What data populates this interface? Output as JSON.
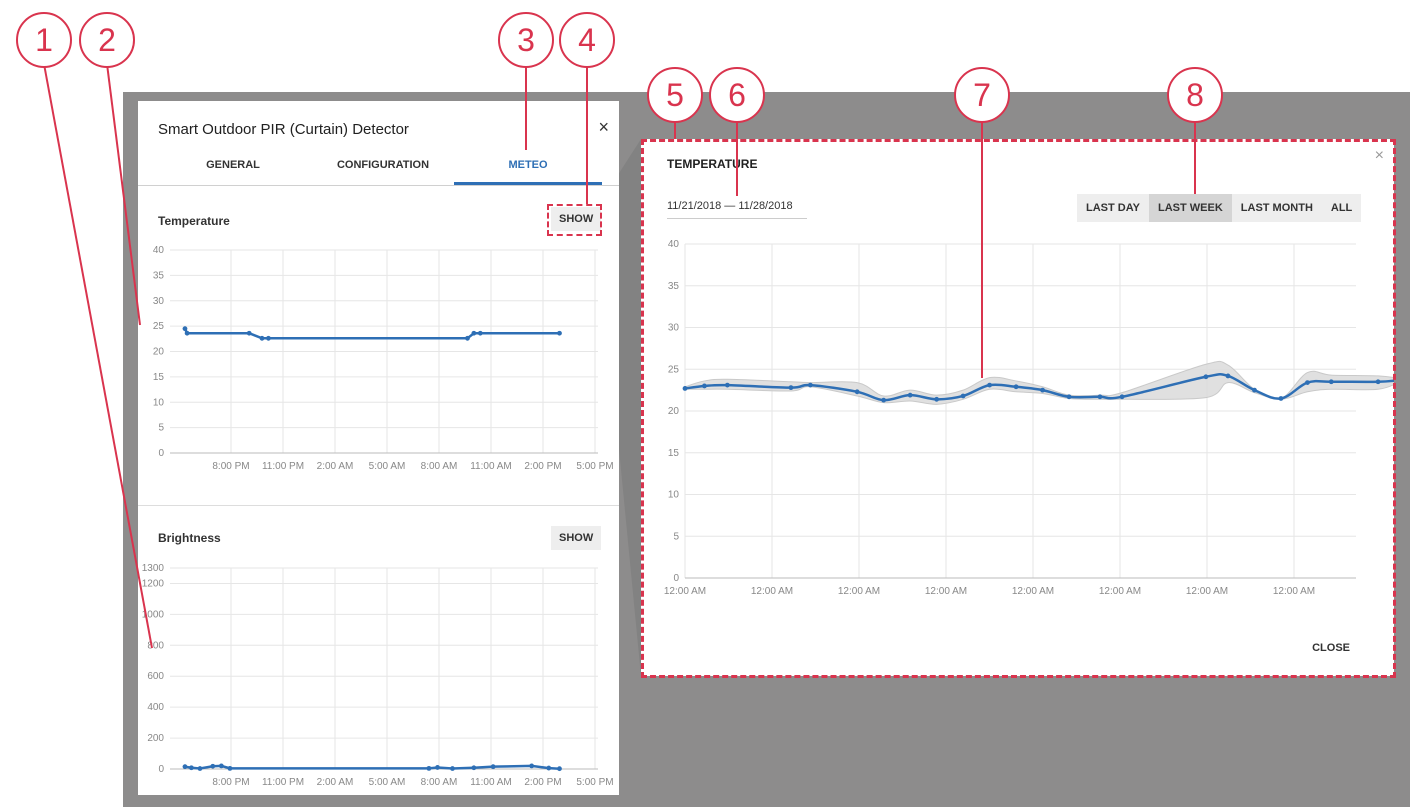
{
  "dialog": {
    "title": "Smart Outdoor PIR (Curtain) Detector",
    "close_symbol": "×",
    "tabs": [
      {
        "label": "GENERAL",
        "active": false
      },
      {
        "label": "CONFIGURATION",
        "active": false
      },
      {
        "label": "METEO",
        "active": true
      }
    ],
    "sections": {
      "temperature": {
        "title": "Temperature",
        "show_label": "SHOW"
      },
      "brightness": {
        "title": "Brightness",
        "show_label": "SHOW"
      }
    }
  },
  "expanded_panel": {
    "title": "TEMPERATURE",
    "close_symbol": "×",
    "date_range": "11/21/2018 — 11/28/2018",
    "range_buttons": [
      {
        "label": "LAST DAY",
        "active": false
      },
      {
        "label": "LAST WEEK",
        "active": true
      },
      {
        "label": "LAST MONTH",
        "active": false
      },
      {
        "label": "ALL",
        "active": false
      }
    ],
    "close_label": "CLOSE"
  },
  "callouts": [
    "1",
    "2",
    "3",
    "4",
    "5",
    "6",
    "7",
    "8"
  ],
  "colors": {
    "accent": "#2e6fb5",
    "annotation": "#d9344e",
    "overlay": "#8d8c8c",
    "band": "#dddddd"
  },
  "chart_data": [
    {
      "type": "line",
      "title": "Temperature",
      "x_tick_labels": [
        "8:00 PM",
        "11:00 PM",
        "2:00 AM",
        "5:00 AM",
        "8:00 AM",
        "11:00 AM",
        "2:00 PM",
        "5:00 PM"
      ],
      "x_hours": [
        -2,
        18
      ],
      "y_tick_labels": [
        "0",
        "5",
        "10",
        "15",
        "20",
        "25",
        "30",
        "35",
        "40"
      ],
      "ylim": [
        0,
        40
      ],
      "grid": true,
      "series": [
        {
          "points": [
            [
              -1.3,
              24.5
            ],
            [
              -1.2,
              23.6
            ],
            [
              1.7,
              23.6
            ],
            [
              2.3,
              22.6
            ],
            [
              2.6,
              22.6
            ],
            [
              11.9,
              22.6
            ],
            [
              12.2,
              23.6
            ],
            [
              12.5,
              23.6
            ],
            [
              16.2,
              23.6
            ]
          ]
        }
      ]
    },
    {
      "type": "line",
      "title": "Brightness",
      "x_tick_labels": [
        "8:00 PM",
        "11:00 PM",
        "2:00 AM",
        "5:00 AM",
        "8:00 AM",
        "11:00 AM",
        "2:00 PM",
        "5:00 PM"
      ],
      "x_hours": [
        -2,
        18
      ],
      "y_tick_labels": [
        "0",
        "200",
        "400",
        "600",
        "800",
        "1000",
        "1200",
        "1300"
      ],
      "ylim": [
        0,
        1300
      ],
      "grid": true,
      "series": [
        {
          "points": [
            [
              -1.3,
              15
            ],
            [
              -1.0,
              8
            ],
            [
              -0.6,
              3
            ],
            [
              0.0,
              18
            ],
            [
              0.4,
              20
            ],
            [
              0.8,
              4
            ],
            [
              10.1,
              4
            ],
            [
              10.5,
              10
            ],
            [
              11.2,
              3
            ],
            [
              12.2,
              8
            ],
            [
              13.1,
              15
            ],
            [
              14.9,
              20
            ],
            [
              15.7,
              6
            ],
            [
              16.2,
              2
            ]
          ]
        }
      ]
    },
    {
      "type": "area",
      "title": "TEMPERATURE",
      "x_tick_labels": [
        "12:00 AM",
        "12:00 AM",
        "12:00 AM",
        "12:00 AM",
        "12:00 AM",
        "12:00 AM",
        "12:00 AM",
        "12:00 AM"
      ],
      "x_days": [
        0,
        7.6
      ],
      "y_tick_labels": [
        "0",
        "5",
        "10",
        "15",
        "20",
        "25",
        "30",
        "35",
        "40"
      ],
      "ylim": [
        0,
        40
      ],
      "grid": true,
      "series": [
        {
          "points": [
            [
              0.0,
              22.7
            ],
            [
              0.22,
              23.0
            ],
            [
              0.48,
              23.1
            ],
            [
              1.2,
              22.8
            ],
            [
              1.42,
              23.1
            ],
            [
              1.95,
              22.3
            ],
            [
              2.25,
              21.3
            ],
            [
              2.55,
              21.9
            ],
            [
              2.85,
              21.4
            ],
            [
              3.15,
              21.8
            ],
            [
              3.45,
              23.1
            ],
            [
              3.75,
              22.9
            ],
            [
              4.05,
              22.5
            ],
            [
              4.35,
              21.7
            ],
            [
              4.7,
              21.7
            ],
            [
              4.95,
              21.7
            ],
            [
              5.9,
              24.1
            ],
            [
              6.15,
              24.2
            ],
            [
              6.45,
              22.5
            ],
            [
              6.75,
              21.5
            ],
            [
              7.05,
              23.4
            ],
            [
              7.32,
              23.5
            ],
            [
              7.85,
              23.5
            ],
            [
              8.1,
              23.7
            ]
          ]
        },
        {
          "name": "max",
          "points": [
            [
              0.0,
              22.9
            ],
            [
              0.22,
              23.6
            ],
            [
              0.48,
              23.8
            ],
            [
              1.2,
              23.5
            ],
            [
              1.42,
              23.4
            ],
            [
              1.95,
              23.4
            ],
            [
              2.25,
              21.8
            ],
            [
              2.55,
              22.5
            ],
            [
              2.85,
              21.9
            ],
            [
              3.15,
              22.5
            ],
            [
              3.45,
              24.0
            ],
            [
              3.75,
              23.6
            ],
            [
              4.05,
              22.9
            ],
            [
              4.35,
              21.9
            ],
            [
              4.7,
              21.9
            ],
            [
              4.95,
              22.2
            ],
            [
              5.9,
              25.6
            ],
            [
              6.15,
              25.5
            ],
            [
              6.45,
              22.6
            ],
            [
              6.75,
              21.5
            ],
            [
              7.05,
              24.6
            ],
            [
              7.32,
              24.3
            ],
            [
              7.85,
              24.2
            ],
            [
              8.1,
              23.9
            ]
          ]
        },
        {
          "name": "min",
          "points": [
            [
              0.0,
              22.6
            ],
            [
              0.22,
              22.6
            ],
            [
              0.48,
              22.6
            ],
            [
              1.2,
              22.4
            ],
            [
              1.42,
              22.9
            ],
            [
              1.95,
              21.8
            ],
            [
              2.25,
              21.0
            ],
            [
              2.55,
              21.2
            ],
            [
              2.85,
              20.8
            ],
            [
              3.15,
              21.4
            ],
            [
              3.45,
              22.6
            ],
            [
              3.75,
              22.3
            ],
            [
              4.05,
              22.1
            ],
            [
              4.35,
              21.5
            ],
            [
              4.7,
              21.4
            ],
            [
              4.95,
              21.4
            ],
            [
              5.9,
              21.6
            ],
            [
              6.15,
              23.4
            ],
            [
              6.45,
              22.2
            ],
            [
              6.75,
              21.4
            ],
            [
              7.05,
              22.3
            ],
            [
              7.32,
              22.6
            ],
            [
              7.85,
              22.6
            ],
            [
              8.1,
              23.5
            ]
          ]
        }
      ]
    }
  ]
}
